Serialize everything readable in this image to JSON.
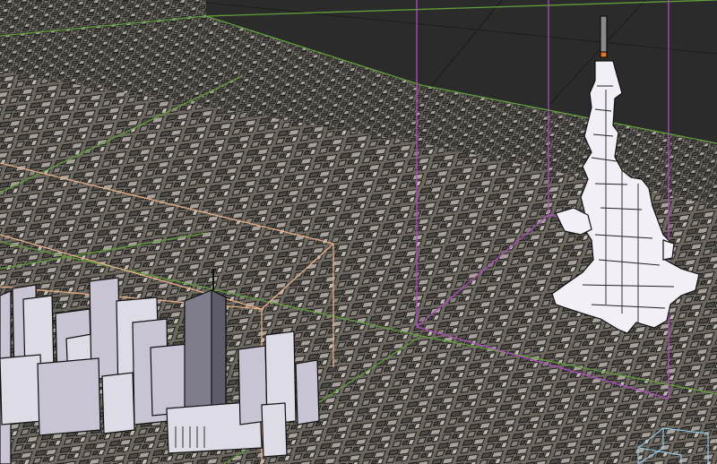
{
  "viewport": {
    "kind": "3d-viewport",
    "shading": "solid-with-outlines",
    "background_color": "#2b2b2b",
    "ground_color": "#6c6860",
    "block_color": "#5a5652",
    "block_top_color": "#b8b0a8",
    "grid_line_color": "#5f9e3a",
    "pink_bounds_color": "#b04cc0",
    "orange_bounds_color": "#e8b088",
    "tower_color": "#f2f0f6",
    "downtown_color": "#c8c4d4",
    "cube_gizmo_color": "#9ad2f0",
    "objects": [
      {
        "name": "city-ground-mesh"
      },
      {
        "name": "branching-tower",
        "selected": true
      },
      {
        "name": "downtown-skyscrapers"
      },
      {
        "name": "cube-gizmo"
      }
    ]
  }
}
